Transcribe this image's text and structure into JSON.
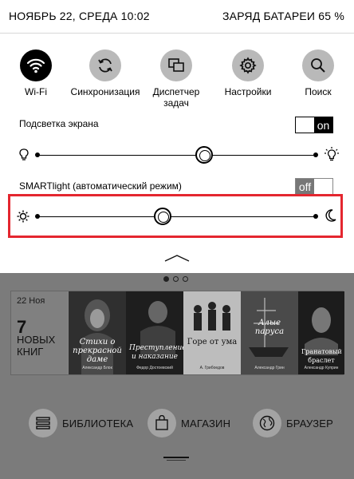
{
  "status_bar": {
    "datetime": "НОЯБРЬ 22, СРЕДА 10:02",
    "battery": "ЗАРЯД БАТАРЕИ 65 %"
  },
  "quick_settings": [
    {
      "label": "Wi-Fi",
      "icon": "wifi-icon",
      "active": true
    },
    {
      "label": "Синхронизация",
      "icon": "sync-icon",
      "active": false
    },
    {
      "label": "Диспетчер задач",
      "icon": "task-manager-icon",
      "active": false
    },
    {
      "label": "Настройки",
      "icon": "gear-icon",
      "active": false
    },
    {
      "label": "Поиск",
      "icon": "search-icon",
      "active": false
    }
  ],
  "backlight": {
    "label": "Подсветка экрана",
    "toggle": "on",
    "level": 0.6
  },
  "smartlight": {
    "label": "SMARTlight (автоматический режим)",
    "toggle": "off",
    "level": 0.45
  },
  "home": {
    "page_dots": 3,
    "active_page": 0,
    "new_books": {
      "date": "22 Ноя",
      "count": "7",
      "text_line1": "НОВЫХ",
      "text_line2": "КНИГ"
    },
    "covers": [
      {
        "title": "Стихи о прекрасной даме",
        "author": "Александр Блок"
      },
      {
        "title": "Преступление и наказание",
        "author": "Федор Достоевский"
      },
      {
        "title": "Горе от ума",
        "author": "А. Грибоедов"
      },
      {
        "title": "Алые паруса",
        "author": "Александр Грин"
      },
      {
        "title": "Гранатовый браслет",
        "author": "Александр Куприн"
      }
    ],
    "nav": [
      {
        "label": "БИБЛИОТЕКА",
        "icon": "library-icon"
      },
      {
        "label": "МАГАЗИН",
        "icon": "store-icon"
      },
      {
        "label": "БРАУЗЕР",
        "icon": "globe-icon"
      }
    ]
  },
  "colors": {
    "highlight": "#e4262f",
    "dimmed_background": "#7b7b7b"
  }
}
